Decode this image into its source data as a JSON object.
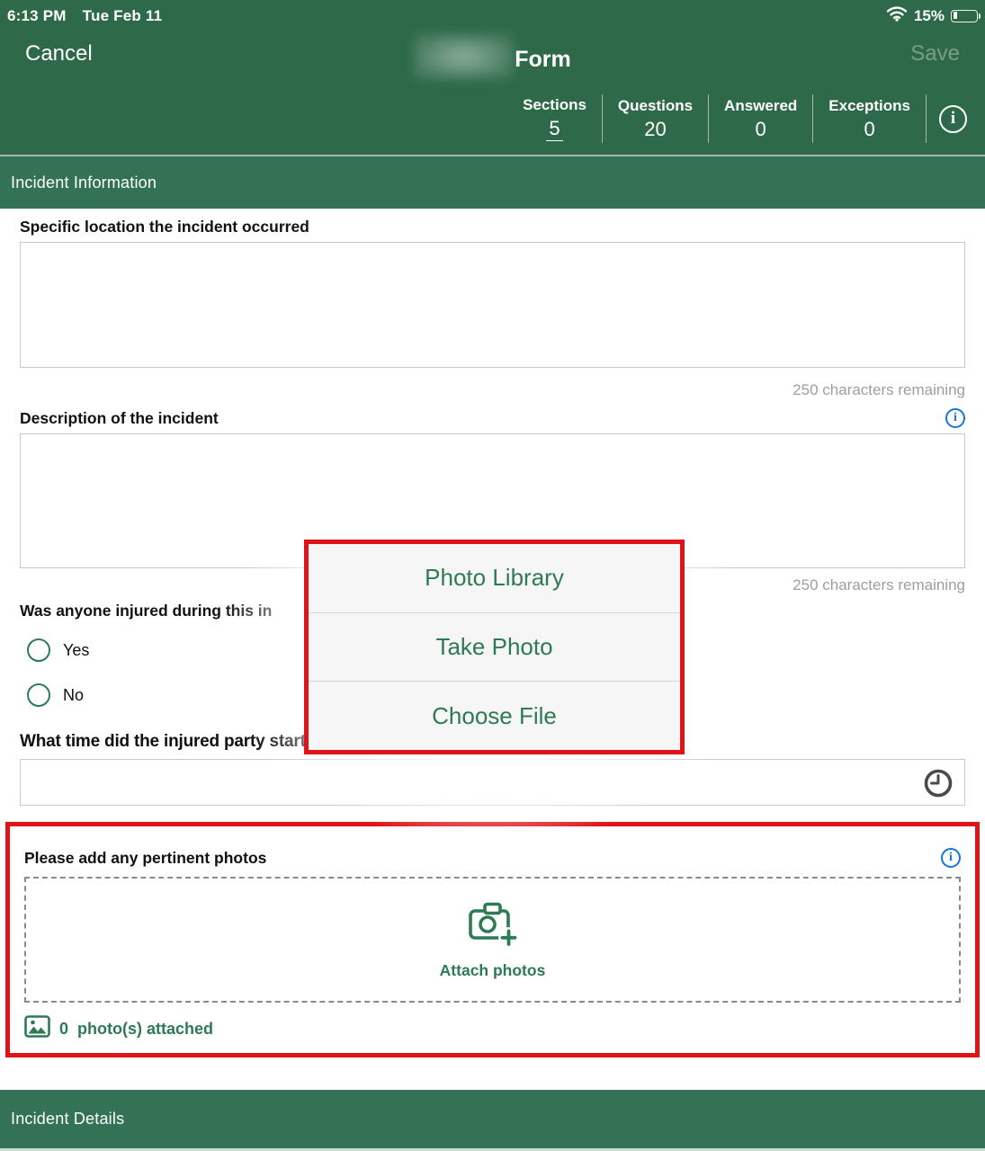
{
  "status_bar": {
    "time": "6:13 PM",
    "date": "Tue Feb 11",
    "battery_percent": "15%"
  },
  "nav": {
    "cancel_label": "Cancel",
    "title": "Form",
    "save_label": "Save"
  },
  "stats": {
    "items": [
      {
        "label": "Sections",
        "value": "5"
      },
      {
        "label": "Questions",
        "value": "20"
      },
      {
        "label": "Answered",
        "value": "0"
      },
      {
        "label": "Exceptions",
        "value": "0"
      }
    ],
    "info_glyph": "i"
  },
  "section_headers": {
    "top": "Incident Information",
    "bottom": "Incident Details"
  },
  "form": {
    "location": {
      "label": "Specific location the incident occurred",
      "remaining": "250 characters remaining"
    },
    "description": {
      "label": "Description of the incident",
      "remaining": "250 characters remaining"
    },
    "injured": {
      "label": "Was anyone injured during this in",
      "options": [
        {
          "label": "Yes"
        },
        {
          "label": "No"
        }
      ]
    },
    "start_time": {
      "label": "What time did the injured party start work on the day of the incident?"
    },
    "photos": {
      "label": "Please add any pertinent photos",
      "attach_label": "Attach photos",
      "count": "0",
      "count_label": "photo(s) attached"
    }
  },
  "action_sheet": {
    "items": [
      {
        "label": "Photo Library"
      },
      {
        "label": "Take Photo"
      },
      {
        "label": "Choose File"
      }
    ]
  },
  "icons": {
    "info_glyph": "i"
  },
  "colors": {
    "header_green": "#2e6a4a",
    "section_green": "#337254",
    "accent_green": "#2d7a55",
    "annotation_red": "#e01418",
    "info_blue": "#1676e0",
    "muted_gray": "#9e9e9e"
  }
}
